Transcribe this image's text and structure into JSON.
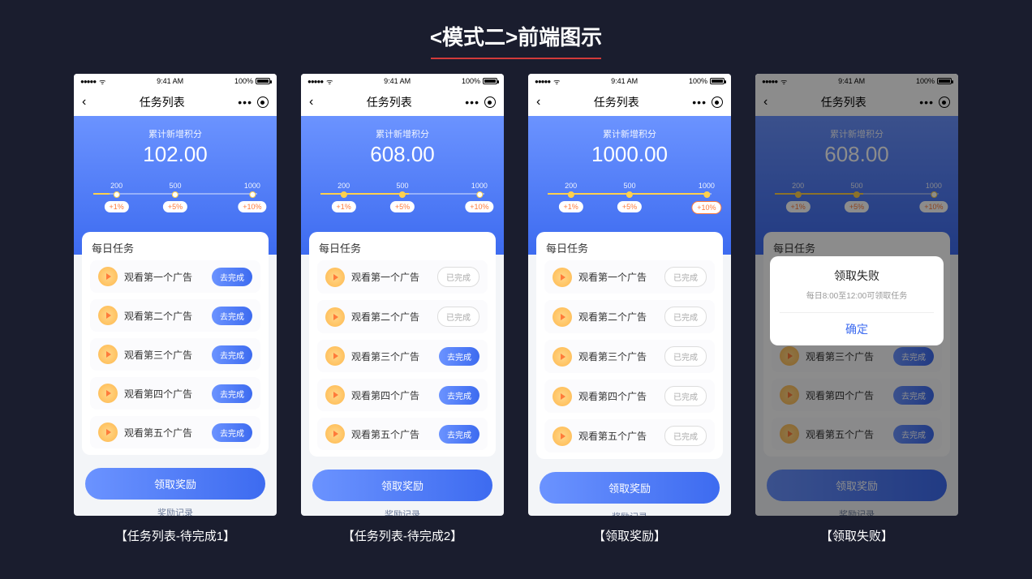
{
  "page": {
    "title": "<模式二>前端图示"
  },
  "status": {
    "time": "9:41 AM",
    "battery_pct": "100%"
  },
  "nav": {
    "title": "任务列表"
  },
  "hero": {
    "label": "累计新增积分"
  },
  "milestones": [
    {
      "threshold": "200",
      "bonus": "+1%"
    },
    {
      "threshold": "500",
      "bonus": "+5%"
    },
    {
      "threshold": "1000",
      "bonus": "+10%"
    }
  ],
  "tasks_header": "每日任务",
  "task_names": [
    "观看第一个广告",
    "观看第二个广告",
    "观看第三个广告",
    "观看第四个广告",
    "观看第五个广告"
  ],
  "btn": {
    "go": "去完成",
    "done": "已完成"
  },
  "footer": {
    "claim": "领取奖励",
    "record": "奖励记录"
  },
  "screens": [
    {
      "caption": "【任务列表-待完成1】",
      "points": "102.00",
      "fill_pct": 10,
      "done_count": 0,
      "ms_hit": 0
    },
    {
      "caption": "【任务列表-待完成2】",
      "points": "608.00",
      "fill_pct": 55,
      "done_count": 2,
      "ms_hit": 2
    },
    {
      "caption": "【领取奖励】",
      "points": "1000.00",
      "fill_pct": 100,
      "done_count": 5,
      "ms_hit": 3
    },
    {
      "caption": "【领取失败】",
      "points": "608.00",
      "fill_pct": 55,
      "done_count": 2,
      "ms_hit": 2,
      "dim": true,
      "modal": {
        "title": "领取失败",
        "subtitle": "每日8:00至12:00可领取任务",
        "ok": "确定"
      }
    }
  ]
}
